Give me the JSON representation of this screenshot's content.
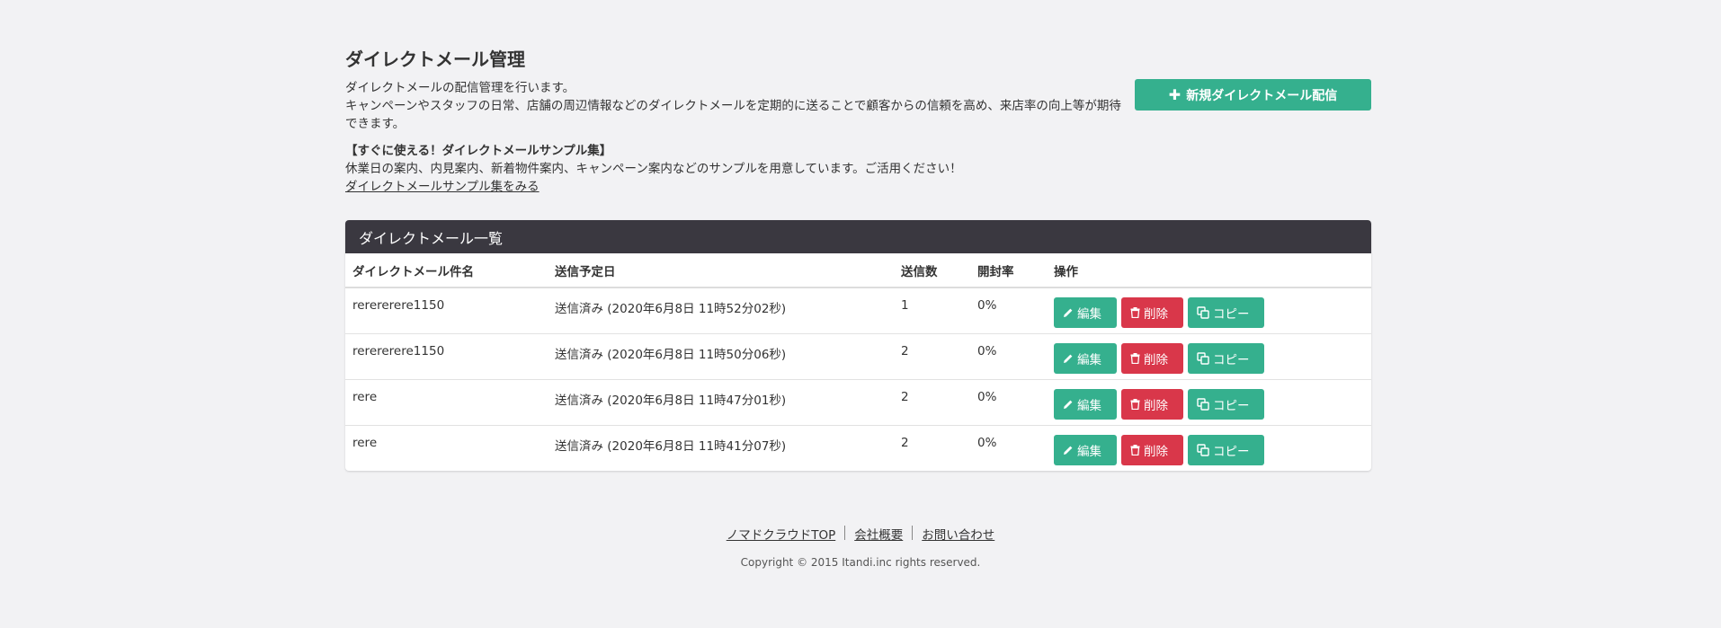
{
  "page": {
    "title": "ダイレクトメール管理",
    "desc_line1": "ダイレクトメールの配信管理を行います。",
    "desc_line2": "キャンペーンやスタッフの日常、店舗の周辺情報などのダイレクトメールを定期的に送ることで顧客からの信頼を高め、来店率の向上等が期待できます。",
    "sample_title": "【すぐに使える！ダイレクトメールサンプル集】",
    "sample_desc": "休業日の案内、内見案内、新着物件案内、キャンペーン案内などのサンプルを用意しています。ご活用ください！",
    "sample_link": "ダイレクトメールサンプル集をみる",
    "new_button": "新規ダイレクトメール配信"
  },
  "panel": {
    "title": "ダイレクトメール一覧",
    "columns": [
      "ダイレクトメール件名",
      "送信予定日",
      "送信数",
      "開封率",
      "操作"
    ],
    "rows": [
      {
        "name": "rerererere1150",
        "date": "送信済み (2020年6月8日 11時52分02秒)",
        "count": "1",
        "rate": "0%"
      },
      {
        "name": "rerererere1150",
        "date": "送信済み (2020年6月8日 11時50分06秒)",
        "count": "2",
        "rate": "0%"
      },
      {
        "name": "rere",
        "date": "送信済み (2020年6月8日 11時47分01秒)",
        "count": "2",
        "rate": "0%"
      },
      {
        "name": "rere",
        "date": "送信済み (2020年6月8日 11時41分07秒)",
        "count": "2",
        "rate": "0%"
      }
    ],
    "edit_label": "編集",
    "delete_label": "削除",
    "copy_label": "コピー"
  },
  "footer": {
    "links": [
      "ノマドクラウドTOP",
      "会社概要",
      "お問い合わせ"
    ],
    "copyright": "Copyright © 2015 Itandi.inc rights reserved."
  },
  "colors": {
    "accent": "#35b08e",
    "danger": "#d9374a",
    "panel_header": "#3a3840",
    "background": "#f2f2f4"
  }
}
